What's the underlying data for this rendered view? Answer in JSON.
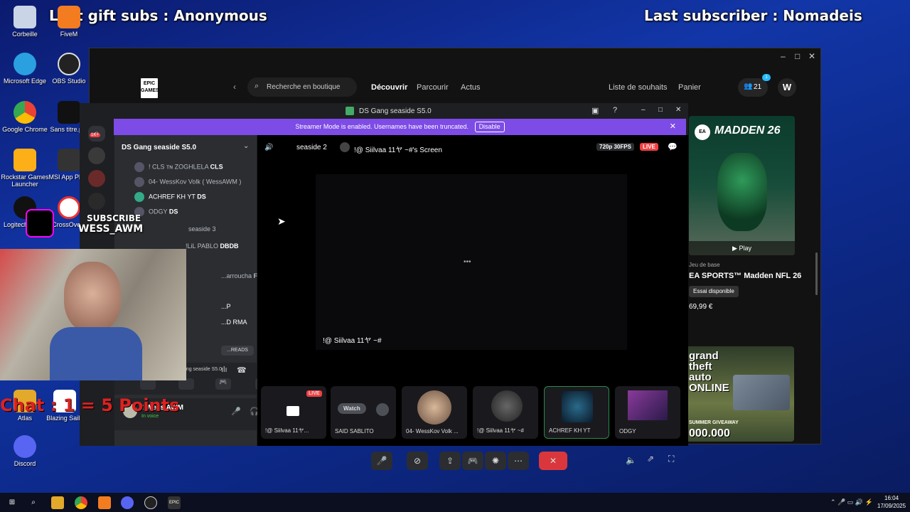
{
  "overlay": {
    "left_text": "Last gift subs : Anonymous",
    "right_text": "Last subscriber : Nomadeis",
    "subscribe_line1": "SUBSCRIBE",
    "subscribe_line2": "WESS_AWM",
    "chat_points": "Chat : 1 = 5 Points"
  },
  "desktop_icons": [
    {
      "label": "Corbeille"
    },
    {
      "label": "FiveM"
    },
    {
      "label": "Microsoft Edge"
    },
    {
      "label": "OBS Studio"
    },
    {
      "label": "Google Chrome"
    },
    {
      "label": "Sans titre.p..."
    },
    {
      "label": "Rockstar Games Launcher"
    },
    {
      "label": "MSI App Pla..."
    },
    {
      "label": "Logitech G H..."
    },
    {
      "label": "CrossOve..."
    },
    {
      "label": "Atlas"
    },
    {
      "label": "Blazing Sails"
    },
    {
      "label": "Discord"
    }
  ],
  "epic": {
    "logo": "EPIC GAMES",
    "search_placeholder": "Recherche en boutique",
    "nav": [
      "Découvrir",
      "Parcourir",
      "Actus"
    ],
    "wishlist": "Liste de souhaits",
    "cart": "Panier",
    "friends_count": "21",
    "friends_badge": "1",
    "avatar_letter": "W",
    "madden": {
      "title_art": "MADDEN 26",
      "play": "Play",
      "type": "Jeu de base",
      "name": "EA SPORTS™ Madden NFL 26",
      "tag": "Essai disponible",
      "price": "69,99 €"
    },
    "gta": {
      "title_art": "grand theft auto ONLINE",
      "promo": "SUMMER GIVEAWAY",
      "amount": "000.000"
    }
  },
  "discord": {
    "window_title": "DS Gang seaside S5.0",
    "banner_text": "Streamer Mode is enabled. Usernames have been truncated.",
    "banner_button": "Disable",
    "rail_badge": "1K+",
    "server_name": "DS Gang seaside S5.0",
    "members": [
      {
        "name": "! CLS ᴛɴ ZOGHLELA",
        "tag": "CLS"
      },
      {
        "name": "04- WessKov Volk ( WessAWM )",
        "tag": ""
      },
      {
        "name": "ACHREF KH YT",
        "tag": "DS"
      },
      {
        "name": "ODGY",
        "tag": "DS"
      }
    ],
    "channel2": "seaside 3",
    "members2": [
      {
        "name": "!LiL PABLO",
        "tag": "DBDB"
      },
      {
        "name": "...arroucha",
        "tag": "FC"
      },
      {
        "name": "...P",
        "tag": ""
      },
      {
        "name": "...D RMA",
        "tag": ""
      }
    ],
    "threads": "...READS",
    "voice_status": "seaside 2 / DS Gang seaside S5.0",
    "user_name": "! Wess AWM",
    "user_status": "In voice",
    "header": {
      "channel": "seaside 2",
      "screen_title": "!@ Siilvaa 11ヤ ~#'s Screen",
      "quality": "720p 30FPS",
      "live": "LIVE"
    },
    "stream_label": "!@ Siilvaa 11ヤ ~#",
    "tiles": [
      {
        "label": "!@ Siilvaa 11ヤ...",
        "live": "LIVE"
      },
      {
        "label": "SAID SABLITO",
        "watch": "Watch"
      },
      {
        "label": "04- WessKov Volk ..."
      },
      {
        "label": "!@ Siilvaa 11ヤ ~#"
      },
      {
        "label": "ACHREF KH YT"
      },
      {
        "label": "ODGY"
      }
    ]
  },
  "taskbar": {
    "time": "16:04",
    "date": "17/09/2025"
  }
}
